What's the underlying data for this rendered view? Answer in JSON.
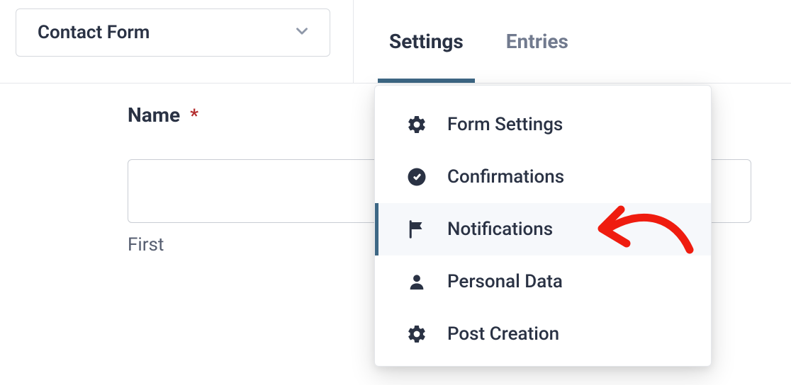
{
  "form_selector": {
    "selected": "Contact Form"
  },
  "tabs": {
    "settings": "Settings",
    "entries": "Entries"
  },
  "field": {
    "label": "Name",
    "required_marker": "*",
    "sub_label": "First"
  },
  "settings_menu": {
    "items": [
      {
        "label": "Form Settings"
      },
      {
        "label": "Confirmations"
      },
      {
        "label": "Notifications"
      },
      {
        "label": "Personal Data"
      },
      {
        "label": "Post Creation"
      }
    ]
  }
}
